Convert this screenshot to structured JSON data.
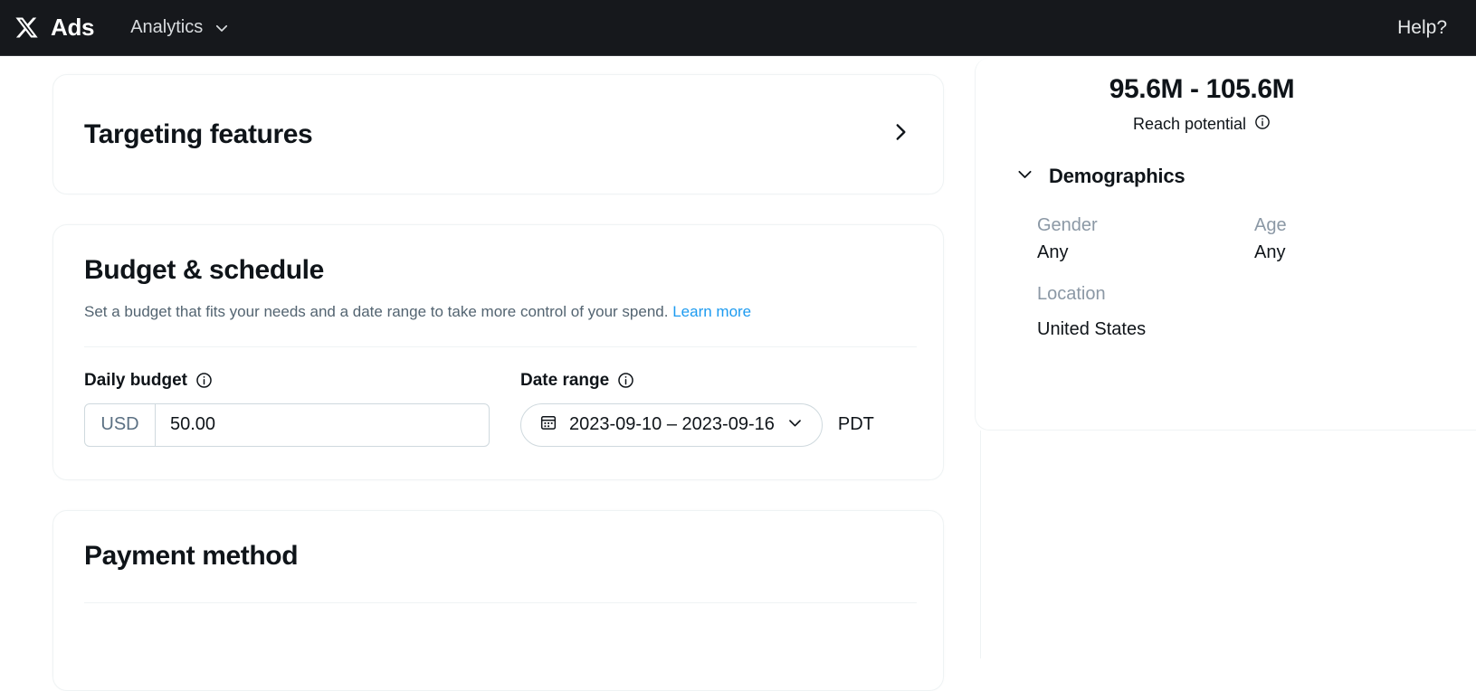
{
  "topbar": {
    "logo_icon": "x-logo-icon",
    "brand_label": "Ads",
    "nav_item_label": "Analytics",
    "nav_chevron_icon": "chevron-down-icon",
    "help_label": "Help?",
    "background_color": "#16181c"
  },
  "main": {
    "targeting_card": {
      "title": "Targeting features",
      "chevron_icon": "chevron-right-icon"
    },
    "budget_card": {
      "title": "Budget & schedule",
      "description": "Set a budget that fits your needs and a date range to take more control of your spend.",
      "learn_more_label": "Learn more",
      "learn_more_color": "#1d9bf0",
      "daily_budget": {
        "label": "Daily budget",
        "info_icon": "info-icon",
        "currency": "USD",
        "value": "50.00",
        "placeholder": "0.00"
      },
      "date_range": {
        "label": "Date range",
        "info_icon": "info-icon",
        "calendar_icon": "calendar-icon",
        "value": "2023-09-10 – 2023-09-16",
        "chevron_icon": "chevron-down-icon",
        "timezone": "PDT"
      }
    },
    "payment_card": {
      "title": "Payment method"
    }
  },
  "sidebar": {
    "reach": {
      "value": "95.6M - 105.6M",
      "caption": "Reach potential",
      "info_icon": "info-icon"
    },
    "demographics": {
      "title": "Demographics",
      "chevron_icon": "chevron-down-icon",
      "fields": [
        {
          "label": "Gender",
          "value": "Any"
        },
        {
          "label": "Age",
          "value": "Any"
        },
        {
          "label": "Location",
          "value": "United States"
        }
      ]
    }
  }
}
